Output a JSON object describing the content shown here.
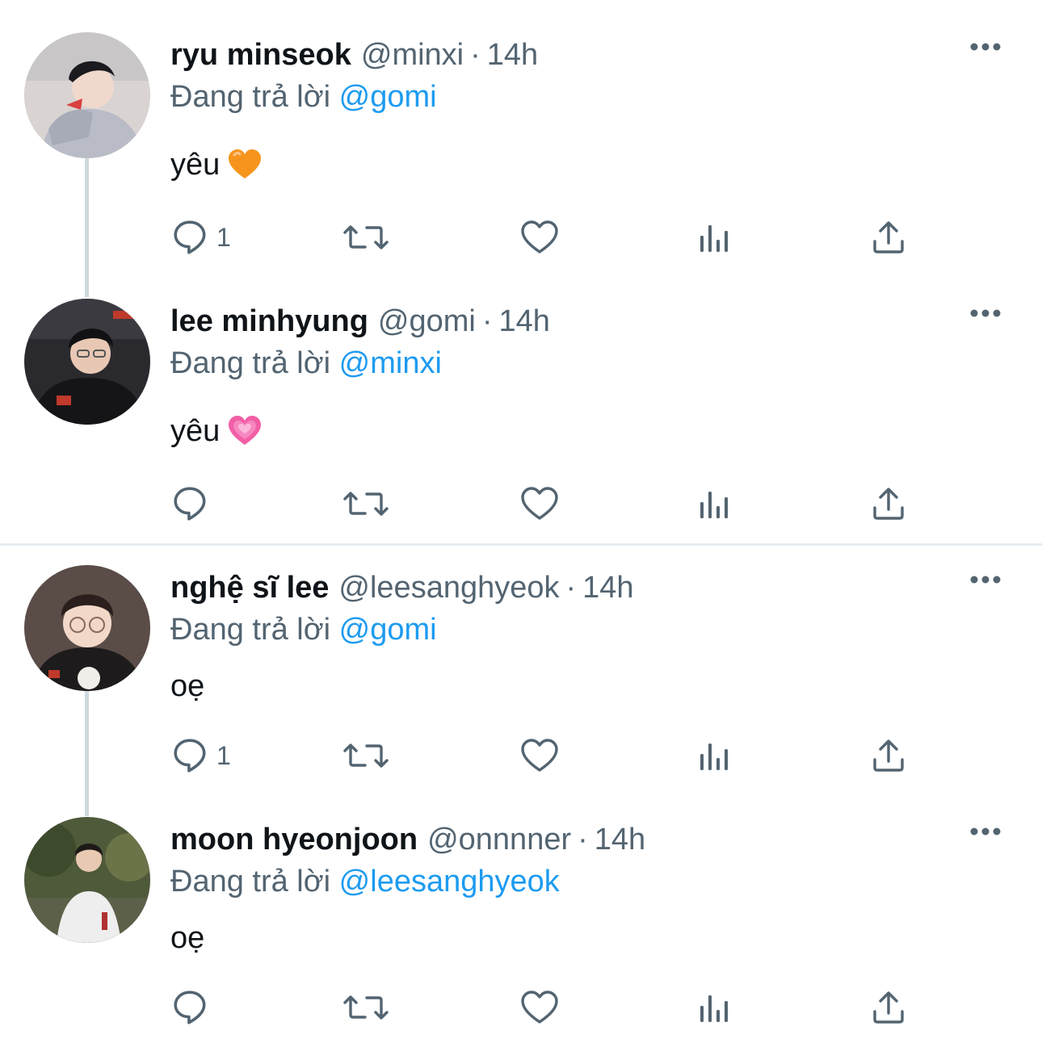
{
  "tweets": [
    {
      "name": "ryu minseok",
      "handle": "@minxi",
      "separator": "·",
      "time": "14h",
      "reply_prefix": "Đang trả lời",
      "reply_to": "@gomi",
      "text": "yêu",
      "emoji": "orange-heart",
      "emoji_color": "#f7941d",
      "reply_count": "1"
    },
    {
      "name": "lee minhyung",
      "handle": "@gomi",
      "separator": "·",
      "time": "14h",
      "reply_prefix": "Đang trả lời",
      "reply_to": "@minxi",
      "text": "yêu",
      "emoji": "growing-pink-heart",
      "emoji_color": "#f25fa6",
      "reply_count": ""
    },
    {
      "name": "nghệ sĩ lee",
      "handle": "@leesanghyeok",
      "separator": "·",
      "time": "14h",
      "reply_prefix": "Đang trả lời",
      "reply_to": "@gomi",
      "text": "oẹ",
      "reply_count": "1"
    },
    {
      "name": "moon hyeonjoon",
      "handle": "@onnnner",
      "separator": "·",
      "time": "14h",
      "reply_prefix": "Đang trả lời",
      "reply_to": "@leesanghyeok",
      "text": "oẹ",
      "reply_count": ""
    }
  ],
  "icons": {
    "reply": "reply-icon",
    "retweet": "retweet-icon",
    "like": "heart-icon",
    "views": "analytics-icon",
    "share": "share-icon",
    "more": "more-icon"
  },
  "colors": {
    "mention": "#1d9bf0",
    "secondary_text": "#536471",
    "icon": "#536471",
    "thread_line": "#cfd9de"
  }
}
